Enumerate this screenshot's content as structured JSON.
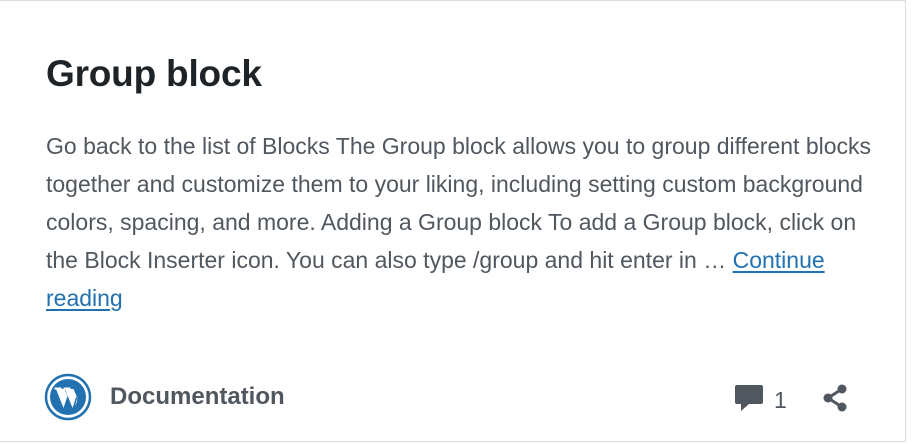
{
  "post": {
    "title": "Group block",
    "excerpt": "Go back to the list of Blocks The Group block allows you to group different blocks together and customize them to your liking, including setting custom background colors, spacing, and more. Adding a Group block To add a Group block, click on the Block Inserter icon. You can also type /group and hit enter in … ",
    "continue_label": "Continue reading"
  },
  "footer": {
    "category_icon": "wordpress-logo-icon",
    "category_label": "Documentation",
    "comment_icon": "comment-bubble-icon",
    "comment_count": "1",
    "share_icon": "share-icon"
  },
  "colors": {
    "title": "#1d2327",
    "text": "#50575e",
    "link": "#2271b1",
    "border": "#dcdcde"
  }
}
